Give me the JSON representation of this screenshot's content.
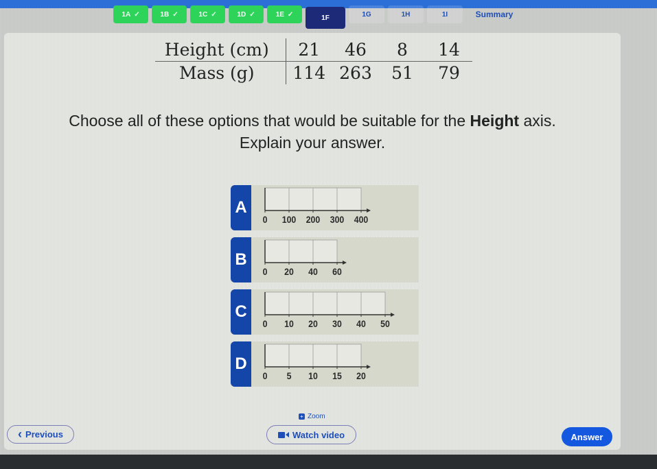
{
  "tabs": [
    {
      "label": "1A",
      "state": "done"
    },
    {
      "label": "1B",
      "state": "done"
    },
    {
      "label": "1C",
      "state": "done"
    },
    {
      "label": "1D",
      "state": "done"
    },
    {
      "label": "1E",
      "state": "done"
    },
    {
      "label": "1F",
      "state": "active"
    },
    {
      "label": "1G",
      "state": "plain"
    },
    {
      "label": "1H",
      "state": "plain"
    },
    {
      "label": "1I",
      "state": "plain"
    },
    {
      "label": "Summary",
      "state": "summary"
    }
  ],
  "check_glyph": "✓",
  "table": {
    "row1": {
      "label": "Height (cm)",
      "values": [
        "21",
        "46",
        "8",
        "14"
      ]
    },
    "row2": {
      "label": "Mass (g)",
      "values": [
        "114",
        "263",
        "51",
        "79"
      ]
    }
  },
  "question": {
    "part1": "Choose all of these options that would be suitable for the ",
    "bold": "Height",
    "part2": " axis.",
    "line2": "Explain your answer."
  },
  "options": [
    {
      "letter": "A",
      "ticks": [
        "0",
        "100",
        "200",
        "300",
        "400"
      ]
    },
    {
      "letter": "B",
      "ticks": [
        "0",
        "20",
        "40",
        "60"
      ]
    },
    {
      "letter": "C",
      "ticks": [
        "0",
        "10",
        "20",
        "30",
        "40",
        "50"
      ]
    },
    {
      "letter": "D",
      "ticks": [
        "0",
        "5",
        "10",
        "15",
        "20"
      ]
    }
  ],
  "zoom": {
    "label": "Zoom",
    "icon": "zoom-icon"
  },
  "buttons": {
    "previous": "Previous",
    "previous_icon": "‹",
    "watch_video": "Watch video",
    "answer": "Answer"
  },
  "colors": {
    "done_tab": "#2ed35a",
    "active_tab": "#1d2a78",
    "accent": "#1558e0",
    "option_letter_bg": "#1445a8"
  }
}
